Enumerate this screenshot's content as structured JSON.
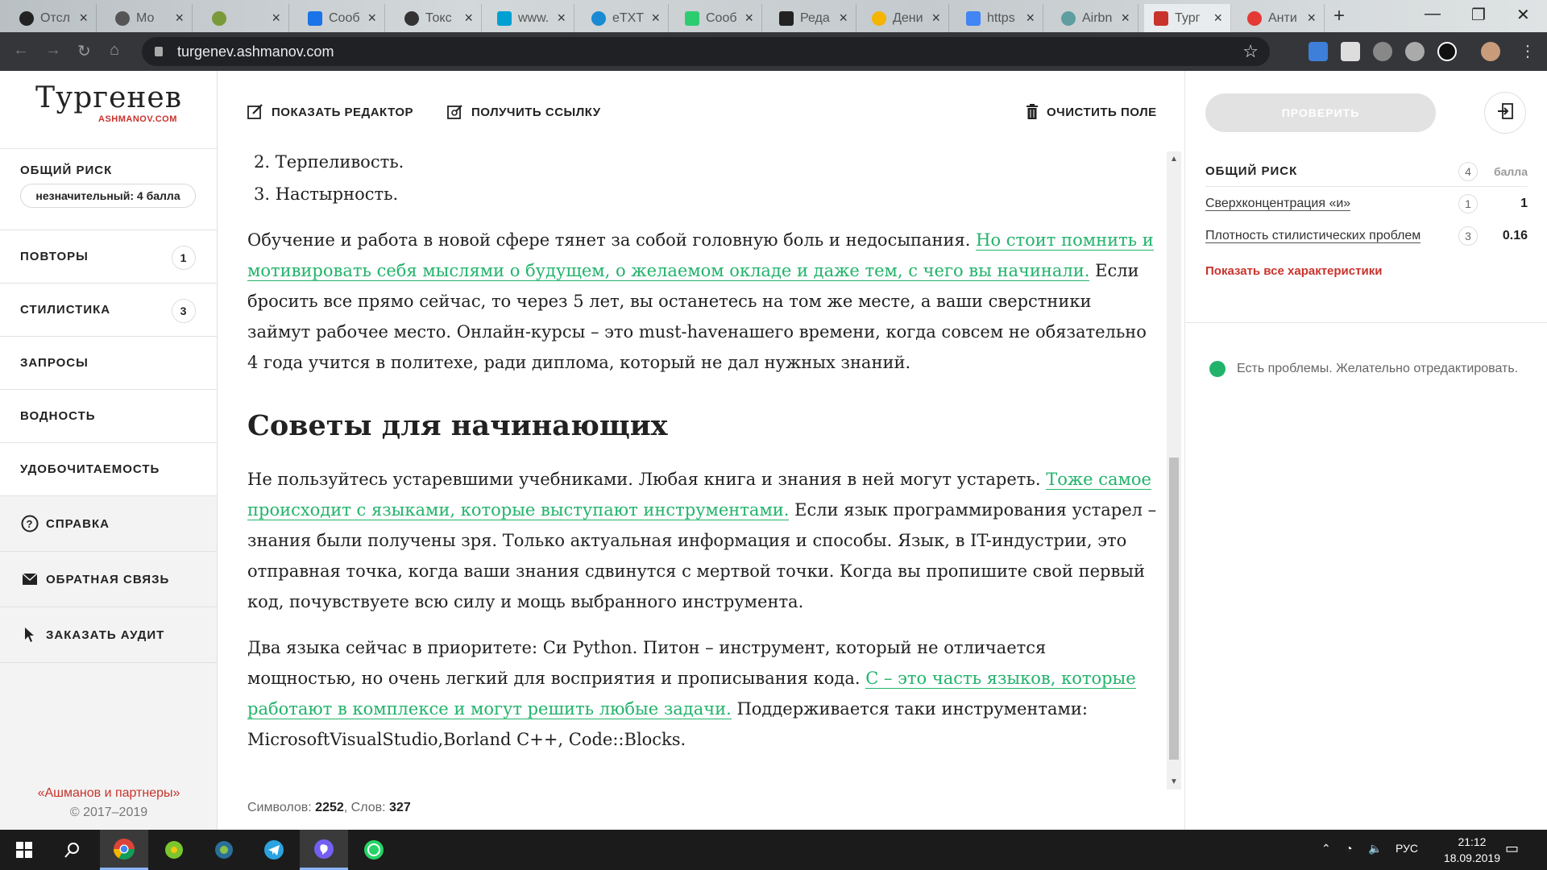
{
  "browser": {
    "tabs": [
      {
        "title": "Отсл",
        "color": "#222222"
      },
      {
        "title": "Мо",
        "color": "#555555"
      },
      {
        "title": "",
        "color": "#7a9a3a"
      },
      {
        "title": "Сооб",
        "color": "#1a73e8"
      },
      {
        "title": "Токс",
        "color": "#333333"
      },
      {
        "title": "www.",
        "color": "#00a0d2"
      },
      {
        "title": "eTXT",
        "color": "#1a8ad4"
      },
      {
        "title": "Сооб",
        "color": "#2ecc71"
      },
      {
        "title": "Реда",
        "color": "#222222"
      },
      {
        "title": "Дени",
        "color": "#f4b400"
      },
      {
        "title": "https",
        "color": "#4285f4"
      },
      {
        "title": "Airbn",
        "color": "#5f9ea0"
      },
      {
        "title": "Тург",
        "color": "#c8332c"
      },
      {
        "title": "Анти",
        "color": "#e53935"
      }
    ],
    "url": "turgenev.ashmanov.com"
  },
  "sidebar": {
    "logo_name": "Тургенев",
    "logo_sub": "ASHMANOV.COM",
    "risk_label": "ОБЩИЙ РИСК",
    "risk_badge": "незначительный: 4 балла",
    "items": [
      {
        "label": "ПОВТОРЫ",
        "count": "1"
      },
      {
        "label": "СТИЛИСТИКА",
        "count": "3"
      },
      {
        "label": "ЗАПРОСЫ",
        "count": ""
      },
      {
        "label": "ВОДНОСТЬ",
        "count": ""
      },
      {
        "label": "УДОБОЧИТАЕМОСТЬ",
        "count": ""
      }
    ],
    "help": "СПРАВКА",
    "feedback": "ОБРАТНАЯ СВЯЗЬ",
    "audit": "ЗАКАЗАТЬ АУДИТ",
    "footer_company": "«Ашманов и партнеры»",
    "footer_copy": "© 2017–2019"
  },
  "toolbar": {
    "show_editor": "ПОКАЗАТЬ РЕДАКТОР",
    "get_link": "ПОЛУЧИТЬ ССЫЛКУ",
    "clear": "ОЧИСТИТЬ ПОЛЕ"
  },
  "editor": {
    "list_item_2": "2. Терпеливость.",
    "list_item_3": "3. Настырность.",
    "p1_a": "Обучение и работа в новой сфере тянет за собой головную боль и недосыпания. ",
    "p1_hl": "Но стоит помнить и мотивировать себя мыслями о будущем, о желаемом окладе и даже тем, с чего вы начинали.",
    "p1_b": " Если бросить все прямо сейчас, то через 5 лет, вы останетесь на том же месте, а ваши сверстники займут рабочее место. Онлайн-курсы – это must-havенашего времени, когда совсем не обязательно 4 года учится в политехе, ради диплома, который не дал нужных знаний.",
    "heading": "Советы для начинающих",
    "p2_a": "Не пользуйтесь устаревшими учебниками. Любая книга и знания в ней могут устареть. ",
    "p2_hl": "Тоже самое происходит с языками, которые выступают инструментами.",
    "p2_b": " Если язык программирования устарел – знания были получены зря. Только актуальная информация и способы. Язык, в IT-индустрии, это отправная точка, когда ваши знания сдвинутся с мертвой точки. Когда вы пропишите свой первый код, почувствуете всю силу и мощь выбранного инструмента.",
    "p3_a": "Два языка сейчас в приоритете: Си Python. Питон – инструмент, который не отличается мощностью, но очень легкий для восприятия и прописывания кода. ",
    "p3_hl": "С – это часть языков, которые работают в комплексе и могут решить любые задачи.",
    "p3_b": " Поддерживается таки инструментами: MicrosoftVisualStudio,Borland C++, Code::Blocks.",
    "chars_label": "Символов:",
    "chars": "2252",
    "words_label": "Слов:",
    "words": "327"
  },
  "rightpanel": {
    "check_button": "ПРОВЕРИТЬ",
    "risk_label": "ОБЩИЙ РИСК",
    "risk_score": "4",
    "risk_unit": "балла",
    "metrics": [
      {
        "name": "Сверхконцентрация «и»",
        "score": "1",
        "value": "1"
      },
      {
        "name": "Плотность стилистических проблем",
        "score": "3",
        "value": "0.16"
      }
    ],
    "show_all": "Показать все характеристики",
    "status": "Есть проблемы. Желательно отредактировать.",
    "status_color": "#22b36b"
  },
  "taskbar": {
    "lang": "РУС",
    "time": "21:12",
    "date": "18.09.2019"
  },
  "colors": {
    "accent_red": "#c8332c",
    "highlight_green": "#22b36b"
  }
}
